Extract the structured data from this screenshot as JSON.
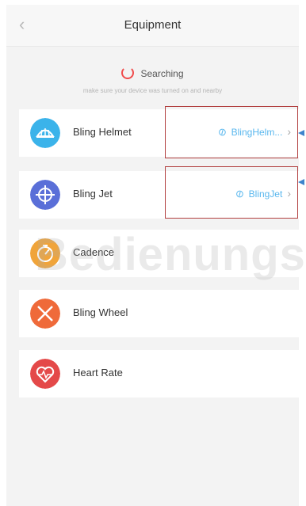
{
  "header": {
    "back_icon": "chevron-left-icon",
    "title": "Equipment"
  },
  "status": {
    "spinner_icon": "loading-spinner-icon",
    "label": "Searching",
    "hint": "make sure your device was turned on and nearby"
  },
  "devices": [
    {
      "name": "Bling Helmet",
      "icon": "helmet-icon",
      "color": "#3bb3ea",
      "linked": "BlingHelm..."
    },
    {
      "name": "Bling Jet",
      "icon": "jet-icon",
      "color": "#5a6fd8",
      "linked": "BlingJet"
    },
    {
      "name": "Cadence",
      "icon": "cadence-icon",
      "color": "#f0a43a",
      "linked": ""
    },
    {
      "name": "Bling Wheel",
      "icon": "wheel-icon",
      "color": "#ef6a3a",
      "linked": ""
    },
    {
      "name": "Heart Rate",
      "icon": "heart-rate-icon",
      "color": "#e44949",
      "linked": ""
    }
  ],
  "watermark": "Bedienungs"
}
